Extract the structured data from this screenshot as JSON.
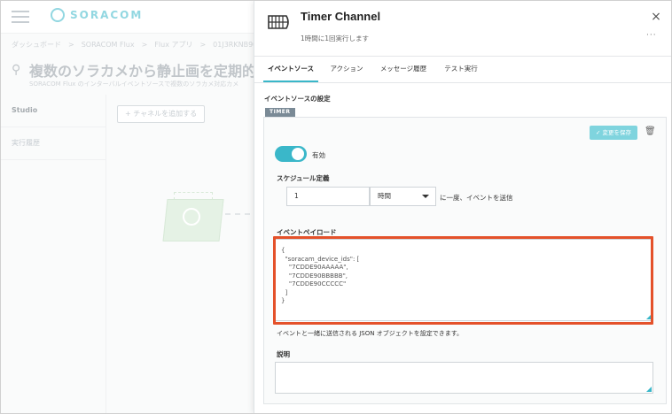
{
  "app": {
    "brand": "SORACOM",
    "breadcrumb": "ダッシュボード　>　SORACOM Flux　>　Flux アプリ　>　01J3RKNB9043",
    "page_title": "複数のソラカメから静止画を定期的",
    "page_desc": "SORACOM Flux のインターバルイベントソースで複数のソラカメ対応カメ"
  },
  "sidebar": {
    "items": [
      {
        "label": "Studio"
      },
      {
        "label": "実行履歴"
      }
    ]
  },
  "canvas": {
    "add_channel_label": "+ チャネルを追加する"
  },
  "panel": {
    "title": "Timer Channel",
    "subtitle": "1時間に1回実行します",
    "close_icon": "×",
    "more_icon": "···",
    "tabs": [
      {
        "label": "イベントソース",
        "active": true
      },
      {
        "label": "アクション"
      },
      {
        "label": "メッセージ履歴"
      },
      {
        "label": "テスト実行"
      }
    ],
    "section_title": "イベントソースの設定",
    "source_tag": "TIMER",
    "save_label": "✓ 変更を保存",
    "toggle": {
      "label": "有効",
      "enabled": true
    },
    "schedule": {
      "label": "スケジュール定義",
      "interval_value": "1",
      "interval_unit": "時間",
      "suffix": "に一度、イベントを送信"
    },
    "payload": {
      "label": "イベントペイロード",
      "lines": [
        "{",
        "  \"soracam_device_ids\": [",
        "    \"7CDDE90AAAAA\",",
        "    \"7CDDE90BBBBB\",",
        "    \"7CDDE90CCCCC\"",
        "  ]",
        "}"
      ],
      "help": "イベントと一緒に送信される JSON オブジェクトを設定できます。"
    },
    "description": {
      "label": "説明",
      "value": ""
    }
  },
  "colors": {
    "accent": "#3ab7c9",
    "highlight": "#e4512a",
    "save_button": "#7fd4de"
  }
}
